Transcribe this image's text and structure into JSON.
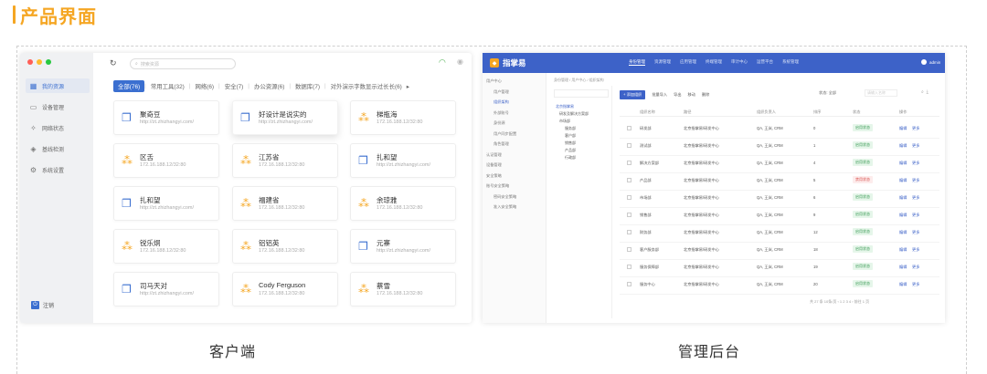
{
  "section_title": "产品界面",
  "captions": {
    "client": "客户端",
    "admin": "管理后台"
  },
  "colors": {
    "accent": "#f5a623",
    "primary": "#3b6fd0",
    "admin_header": "#3d62c8"
  },
  "client": {
    "sidebar": [
      {
        "label": "我的资源",
        "icon": "grid-icon",
        "glyph": "▦",
        "active": true
      },
      {
        "label": "设备管理",
        "icon": "device-icon",
        "glyph": "▭",
        "active": false
      },
      {
        "label": "网络状态",
        "icon": "network-icon",
        "glyph": "✧",
        "active": false
      },
      {
        "label": "基线检测",
        "icon": "shield-icon",
        "glyph": "◈",
        "active": false
      },
      {
        "label": "系统设置",
        "icon": "gear-icon",
        "glyph": "⚙",
        "active": false
      }
    ],
    "logout_label": "注销",
    "search_placeholder": "搜索资源",
    "tabs": [
      {
        "label": "全部(76)",
        "active": true
      },
      {
        "label": "常用工具(32)"
      },
      {
        "label": "网络(6)"
      },
      {
        "label": "安全(7)"
      },
      {
        "label": "办公资源(6)"
      },
      {
        "label": "数据库(7)"
      },
      {
        "label": "对外演示字数显示过长长(6)"
      }
    ],
    "cards": [
      {
        "name": "聚奇豆",
        "addr": "http://zt.zhizhangyi.com/",
        "type": "web"
      },
      {
        "name": "好设计是说实的",
        "addr": "http://zt.zhizhangyi.com/",
        "type": "web"
      },
      {
        "name": "梯瓶海",
        "addr": "172.16.188.12/32:80",
        "type": "host"
      },
      {
        "name": "区舌",
        "addr": "172.16.188.12/32:80",
        "type": "host"
      },
      {
        "name": "江苏省",
        "addr": "172.16.188.12/32:80",
        "type": "host"
      },
      {
        "name": "扎和望",
        "addr": "http://zt.zhizhangyi.com/",
        "type": "web"
      },
      {
        "name": "扎和望",
        "addr": "http://zt.zhizhangyi.com/",
        "type": "web"
      },
      {
        "name": "福建省",
        "addr": "172.16.188.12/32:80",
        "type": "host"
      },
      {
        "name": "余琼雅",
        "addr": "172.16.188.12/32:80",
        "type": "host"
      },
      {
        "name": "锐乐炯",
        "addr": "172.16.188.12/32:80",
        "type": "host"
      },
      {
        "name": "铝铝英",
        "addr": "172.16.188.12/32:80",
        "type": "host"
      },
      {
        "name": "元寨",
        "addr": "http://zt.zhizhangyi.com/",
        "type": "web"
      },
      {
        "name": "司马天对",
        "addr": "http://zt.zhizhangyi.com/",
        "type": "web"
      },
      {
        "name": "Cody Ferguson",
        "addr": "172.16.188.12/32:80",
        "type": "host"
      },
      {
        "name": "蔡雪",
        "addr": "172.16.188.12/32:80",
        "type": "host"
      }
    ]
  },
  "admin": {
    "logo": "指掌易",
    "topnav": [
      "身份管理",
      "资源管理",
      "应用管理",
      "终端管理",
      "审计中心",
      "运营平台",
      "系统管理"
    ],
    "user": "admin",
    "sidebar": [
      "用户中心",
      "用户管理",
      "组织架构",
      "外部账号",
      "身份源",
      "用户同步配置",
      "角色管理",
      "认证管理",
      "设备管理",
      "安全策略",
      "账号安全策略",
      "密码安全策略",
      "准入安全策略"
    ],
    "breadcrumb": "身份管理 / 用户中心 / 组织架构",
    "tree_search": "搜索",
    "tree": [
      "北京指掌易",
      "研发及解决方案部",
      "市场部",
      "服务部",
      "客户部",
      "销售部",
      "产品部",
      "行政部"
    ],
    "toolbar": {
      "add": "+ 添加组织",
      "items": [
        "批量导入",
        "导出",
        "移动",
        "删除"
      ]
    },
    "filter_label": "状态: 全部",
    "filter_placeholder": "请输入名称",
    "table_headers": [
      "组织名称",
      "路径",
      "组织负责人",
      "排序",
      "状态",
      "操作"
    ],
    "rows": [
      {
        "name": "研发部",
        "path": "北京指掌易/研发中心",
        "owner": "QA, 王岚, CRM",
        "sort": "0",
        "status": "启用状态",
        "on": true
      },
      {
        "name": "测试部",
        "path": "北京指掌易/研发中心",
        "owner": "QA, 王岚, CRM",
        "sort": "1",
        "status": "启用状态",
        "on": true
      },
      {
        "name": "解决方案部",
        "path": "北京指掌易/研发中心",
        "owner": "QA, 王岚, CRM",
        "sort": "4",
        "status": "启用状态",
        "on": true
      },
      {
        "name": "产品部",
        "path": "北京指掌易/研发中心",
        "owner": "QA, 王岚, CRM",
        "sort": "5",
        "status": "禁用状态",
        "on": false
      },
      {
        "name": "市场部",
        "path": "北京指掌易/研发中心",
        "owner": "QA, 王岚, CRM",
        "sort": "6",
        "status": "启用状态",
        "on": true
      },
      {
        "name": "销售部",
        "path": "北京指掌易/研发中心",
        "owner": "QA, 王岚, CRM",
        "sort": "9",
        "status": "启用状态",
        "on": true
      },
      {
        "name": "财务部",
        "path": "北京指掌易/研发中心",
        "owner": "QA, 王岚, CRM",
        "sort": "12",
        "status": "启用状态",
        "on": true
      },
      {
        "name": "客户服务部",
        "path": "北京指掌易/研发中心",
        "owner": "QA, 王岚, CRM",
        "sort": "18",
        "status": "启用状态",
        "on": true
      },
      {
        "name": "服务保障部",
        "path": "北京指掌易/研发中心",
        "owner": "QA, 王岚, CRM",
        "sort": "19",
        "status": "启用状态",
        "on": true
      },
      {
        "name": "服务中心",
        "path": "北京指掌易/研发中心",
        "owner": "QA, 王岚, CRM",
        "sort": "20",
        "status": "启用状态",
        "on": true
      }
    ],
    "ops": [
      "编辑",
      "更多"
    ],
    "pager": "共 27 条   10条/页   ‹  1  2  3  4  ›   前往  1  页"
  }
}
